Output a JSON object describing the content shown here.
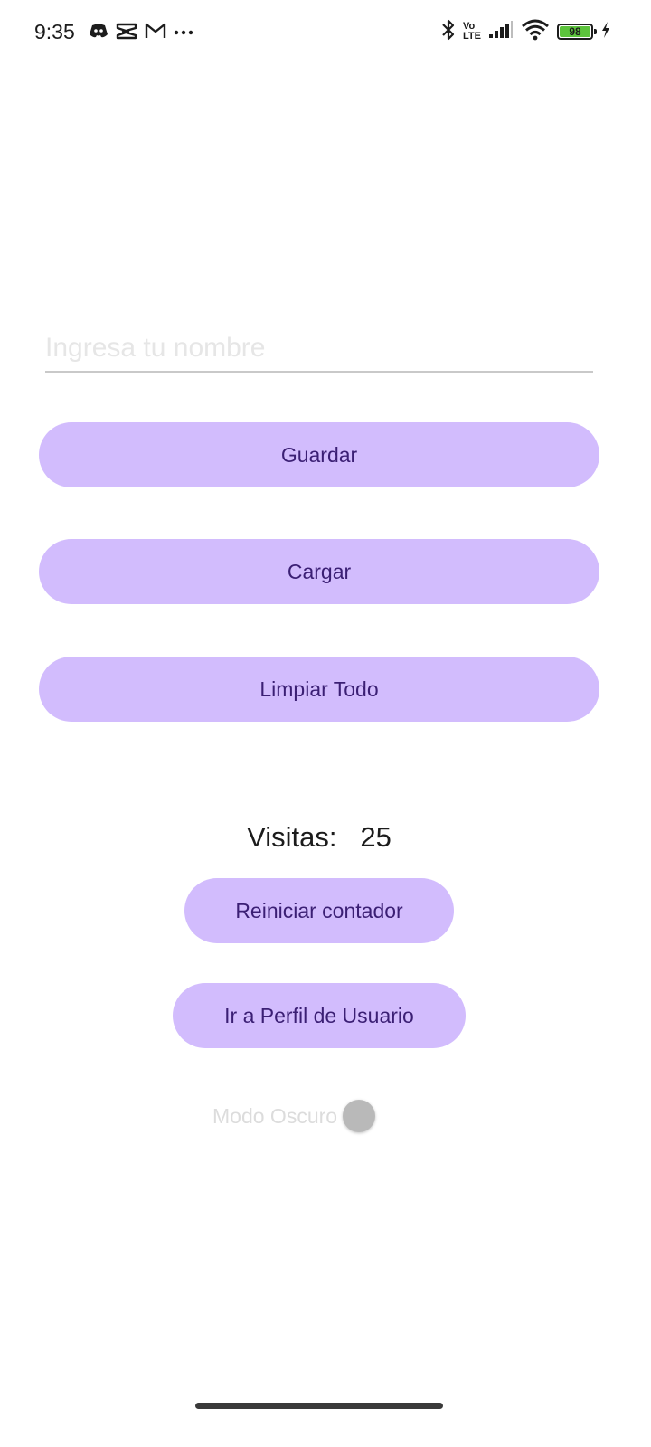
{
  "status_bar": {
    "time": "9:35",
    "left_icons": [
      "discord-icon",
      "capcut-icon",
      "gmail-icon",
      "more-dots-icon"
    ],
    "right_icons": [
      "bluetooth-icon",
      "volte-icon",
      "signal-icon",
      "wifi-icon",
      "battery-icon",
      "charging-icon"
    ],
    "volte_top": "Vo",
    "volte_bottom": "LTE",
    "battery_level": "98",
    "battery_color": "#5cc33c"
  },
  "form": {
    "name_placeholder": "Ingresa tu nombre",
    "name_value": ""
  },
  "buttons": {
    "save_label": "Guardar",
    "load_label": "Cargar",
    "clear_label": "Limpiar Todo",
    "reset_counter_label": "Reiniciar contador",
    "profile_label": "Ir a Perfil de Usuario"
  },
  "counter": {
    "label": "Visitas:",
    "value": "25"
  },
  "dark_mode": {
    "label": "Modo Oscuro",
    "enabled": false
  },
  "colors": {
    "button_bg": "#d2bcfd",
    "button_text": "#3b1f74",
    "switch_thumb": "#b9b9b9"
  }
}
